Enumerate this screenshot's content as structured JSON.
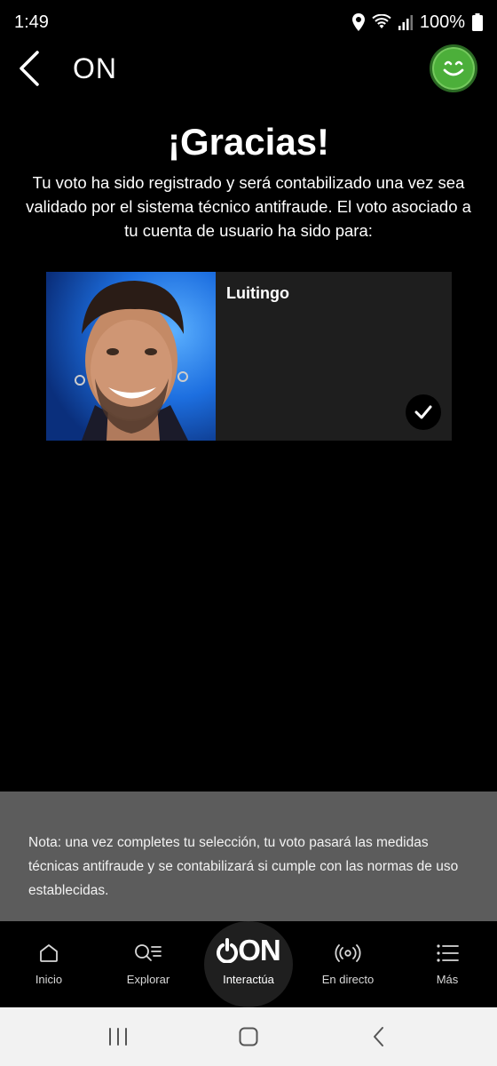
{
  "status_bar": {
    "time": "1:49",
    "battery": "100%",
    "icons": [
      "location-icon",
      "wifi-icon",
      "signal-icon",
      "battery-icon"
    ]
  },
  "header": {
    "title": "ON",
    "back_icon": "chevron-left-icon",
    "avatar_icon": "smiley-face-icon"
  },
  "main": {
    "title": "¡Gracias!",
    "message": "Tu voto ha sido registrado y será contabilizado una vez sea validado por el sistema técnico antifraude. El voto asociado a tu cuenta de usuario ha sido para:",
    "vote_card": {
      "name": "Luitingo",
      "selected": true,
      "check_icon": "checkmark-icon"
    }
  },
  "note": {
    "text": "Nota: una vez completes tu selección, tu voto pasará las medidas técnicas antifraude y se contabilizará si cumple con las normas de uso establecidas."
  },
  "bottom_nav": {
    "items": [
      {
        "label": "Inicio",
        "icon": "home-icon"
      },
      {
        "label": "Explorar",
        "icon": "search-list-icon"
      },
      {
        "label": "Interactúa",
        "icon": "on-logo-icon",
        "logo_text": "ON",
        "active": true
      },
      {
        "label": "En directo",
        "icon": "broadcast-icon"
      },
      {
        "label": "Más",
        "icon": "menu-list-icon"
      }
    ]
  },
  "system_nav": {
    "buttons": [
      "recent-apps-icon",
      "home-circle-icon",
      "back-icon"
    ]
  },
  "colors": {
    "background": "#000000",
    "card": "#1e1e1e",
    "note_background": "#5c5c5c",
    "avatar_green": "#4caf3a",
    "system_nav": "#f2f2f2"
  }
}
